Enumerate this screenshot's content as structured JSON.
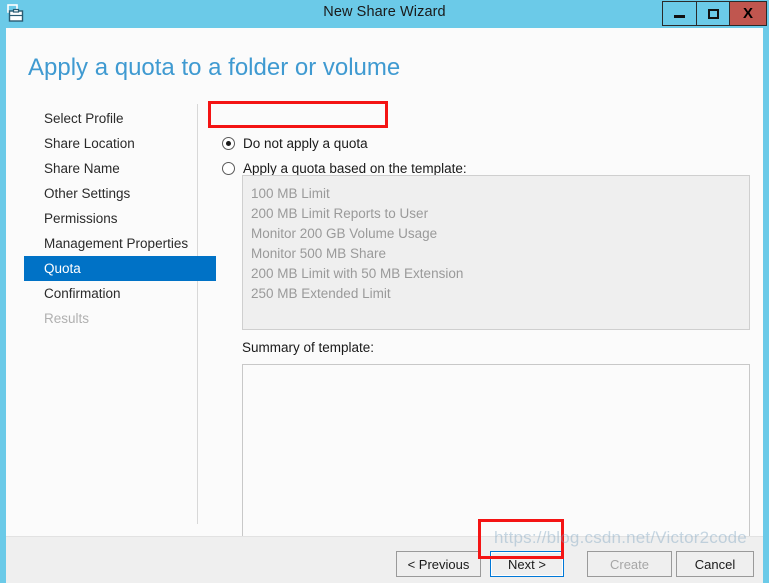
{
  "window": {
    "title": "New Share Wizard",
    "icon": "share-wizard-icon",
    "minimize_label": "Minimize",
    "maximize_label": "Maximize",
    "close_label": "X"
  },
  "page": {
    "heading": "Apply a quota to a folder or volume"
  },
  "nav": {
    "items": [
      {
        "label": "Select Profile",
        "state": "normal"
      },
      {
        "label": "Share Location",
        "state": "normal"
      },
      {
        "label": "Share Name",
        "state": "normal"
      },
      {
        "label": "Other Settings",
        "state": "normal"
      },
      {
        "label": "Permissions",
        "state": "normal"
      },
      {
        "label": "Management Properties",
        "state": "normal"
      },
      {
        "label": "Quota",
        "state": "selected"
      },
      {
        "label": "Confirmation",
        "state": "normal"
      },
      {
        "label": "Results",
        "state": "disabled"
      }
    ]
  },
  "quota": {
    "option_no_quota": "Do not apply a quota",
    "option_template": "Apply a quota based on the template:",
    "selected_option": "no_quota",
    "templates": [
      "100 MB Limit",
      "200 MB Limit Reports to User",
      "Monitor 200 GB Volume Usage",
      "Monitor 500 MB Share",
      "200 MB Limit with 50 MB Extension",
      "250 MB Extended Limit"
    ],
    "summary_label": "Summary of template:",
    "summary_text": ""
  },
  "footer": {
    "previous_label": "< Previous",
    "next_label": "Next >",
    "create_label": "Create",
    "cancel_label": "Cancel"
  },
  "watermark": {
    "text": "https://blog.csdn.net/Victor2code"
  },
  "colors": {
    "titlebar": "#6bcae8",
    "close_button": "#c0564f",
    "heading": "#3f9ad1",
    "nav_selected": "#0072c6",
    "annotation": "#f41414",
    "focus_border": "#0078d7"
  }
}
